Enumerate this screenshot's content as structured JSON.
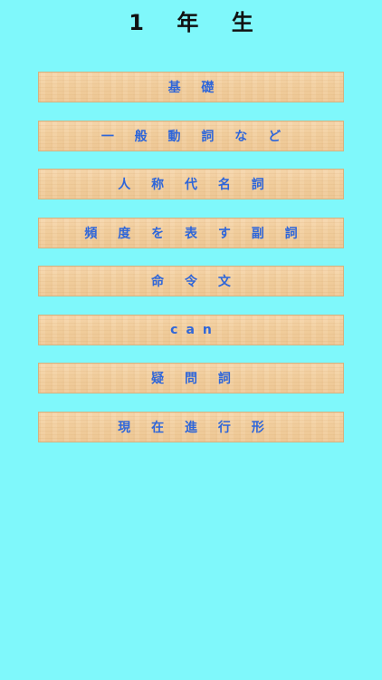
{
  "header": {
    "title": "1 年 生"
  },
  "menu": {
    "items": [
      {
        "label": "基 礎"
      },
      {
        "label": "一 般 動 詞 な ど"
      },
      {
        "label": "人 称 代 名 詞"
      },
      {
        "label": "頻 度 を 表 す 副 詞"
      },
      {
        "label": "命 令 文"
      },
      {
        "label": "can"
      },
      {
        "label": "疑 問 詞"
      },
      {
        "label": "現 在 進 行 形"
      }
    ]
  },
  "colors": {
    "background": "#7ff8fb",
    "button_text": "#2f66d9",
    "title_text": "#111111",
    "button_wood": "#f2cf9f"
  }
}
